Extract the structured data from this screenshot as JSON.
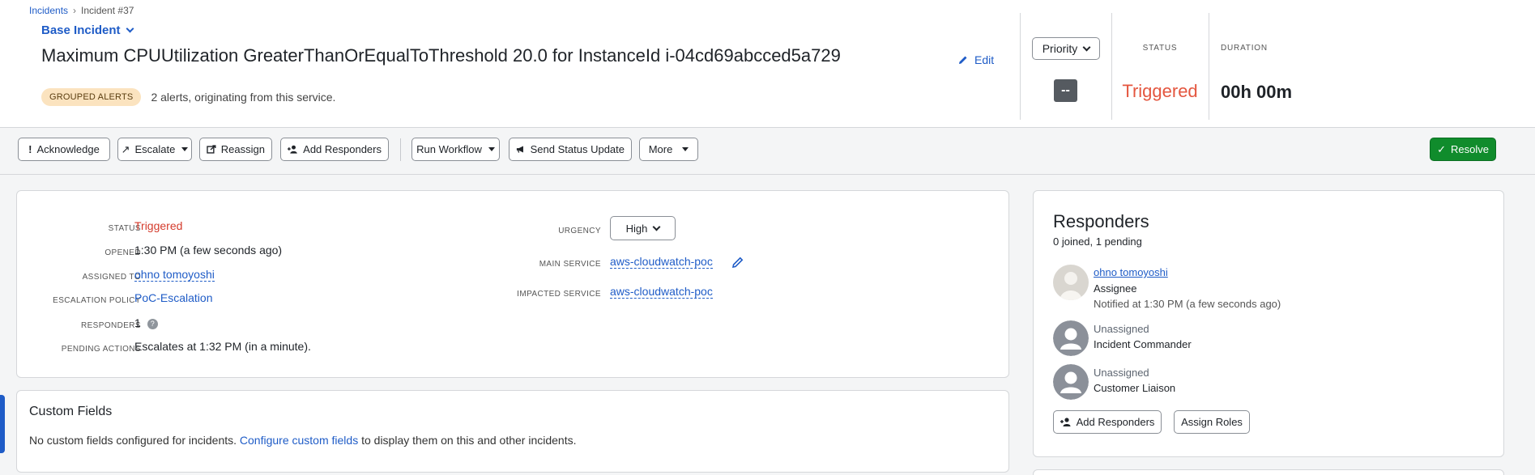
{
  "breadcrumb": {
    "root": "Incidents",
    "current": "Incident #37"
  },
  "header": {
    "base_incident": "Base Incident",
    "title": "Maximum CPUUtilization GreaterThanOrEqualToThreshold 20.0 for InstanceId i-04cd69abcced5a729",
    "edit": "Edit",
    "grouped_badge": "GROUPED ALERTS",
    "grouped_text": "2 alerts, originating from this service.",
    "priority_label": "Priority",
    "priority_value": "--",
    "status_label": "STATUS",
    "status_value": "Triggered",
    "duration_label": "DURATION",
    "duration_value": "00h 00m"
  },
  "toolbar": {
    "acknowledge": "Acknowledge",
    "escalate": "Escalate",
    "reassign": "Reassign",
    "add_responders": "Add Responders",
    "run_workflow": "Run Workflow",
    "send_status_update": "Send Status Update",
    "more": "More",
    "resolve": "Resolve"
  },
  "details": {
    "status_label": "STATUS",
    "status_value": "Triggered",
    "opened_label": "OPENED",
    "opened_value": "1:30 PM (a few seconds ago)",
    "assigned_label": "ASSIGNED TO",
    "assigned_value": "ohno tomoyoshi",
    "escalation_label": "ESCALATION POLICY",
    "escalation_value": "PoC-Escalation",
    "responders_label": "RESPONDERS",
    "responders_value": "1",
    "pending_label": "PENDING ACTIONS",
    "pending_value": "Escalates at 1:32 PM (in a minute).",
    "urgency_label": "URGENCY",
    "urgency_value": "High",
    "main_service_label": "MAIN SERVICE",
    "main_service_value": "aws-cloudwatch-poc",
    "impacted_service_label": "IMPACTED SERVICE",
    "impacted_service_value": "aws-cloudwatch-poc"
  },
  "custom_fields": {
    "title": "Custom Fields",
    "text_before": "No custom fields configured for incidents.",
    "link": "Configure custom fields",
    "text_after": "to display them on this and other incidents."
  },
  "responders": {
    "title": "Responders",
    "summary": "0 joined, 1 pending",
    "items": [
      {
        "name": "ohno tomoyoshi",
        "role": "Assignee",
        "note": "Notified at 1:30 PM (a few seconds ago)"
      },
      {
        "name": "Unassigned",
        "role": "Incident Commander"
      },
      {
        "name": "Unassigned",
        "role": "Customer Liaison"
      }
    ],
    "add_responders": "Add Responders",
    "assign_roles": "Assign Roles"
  }
}
